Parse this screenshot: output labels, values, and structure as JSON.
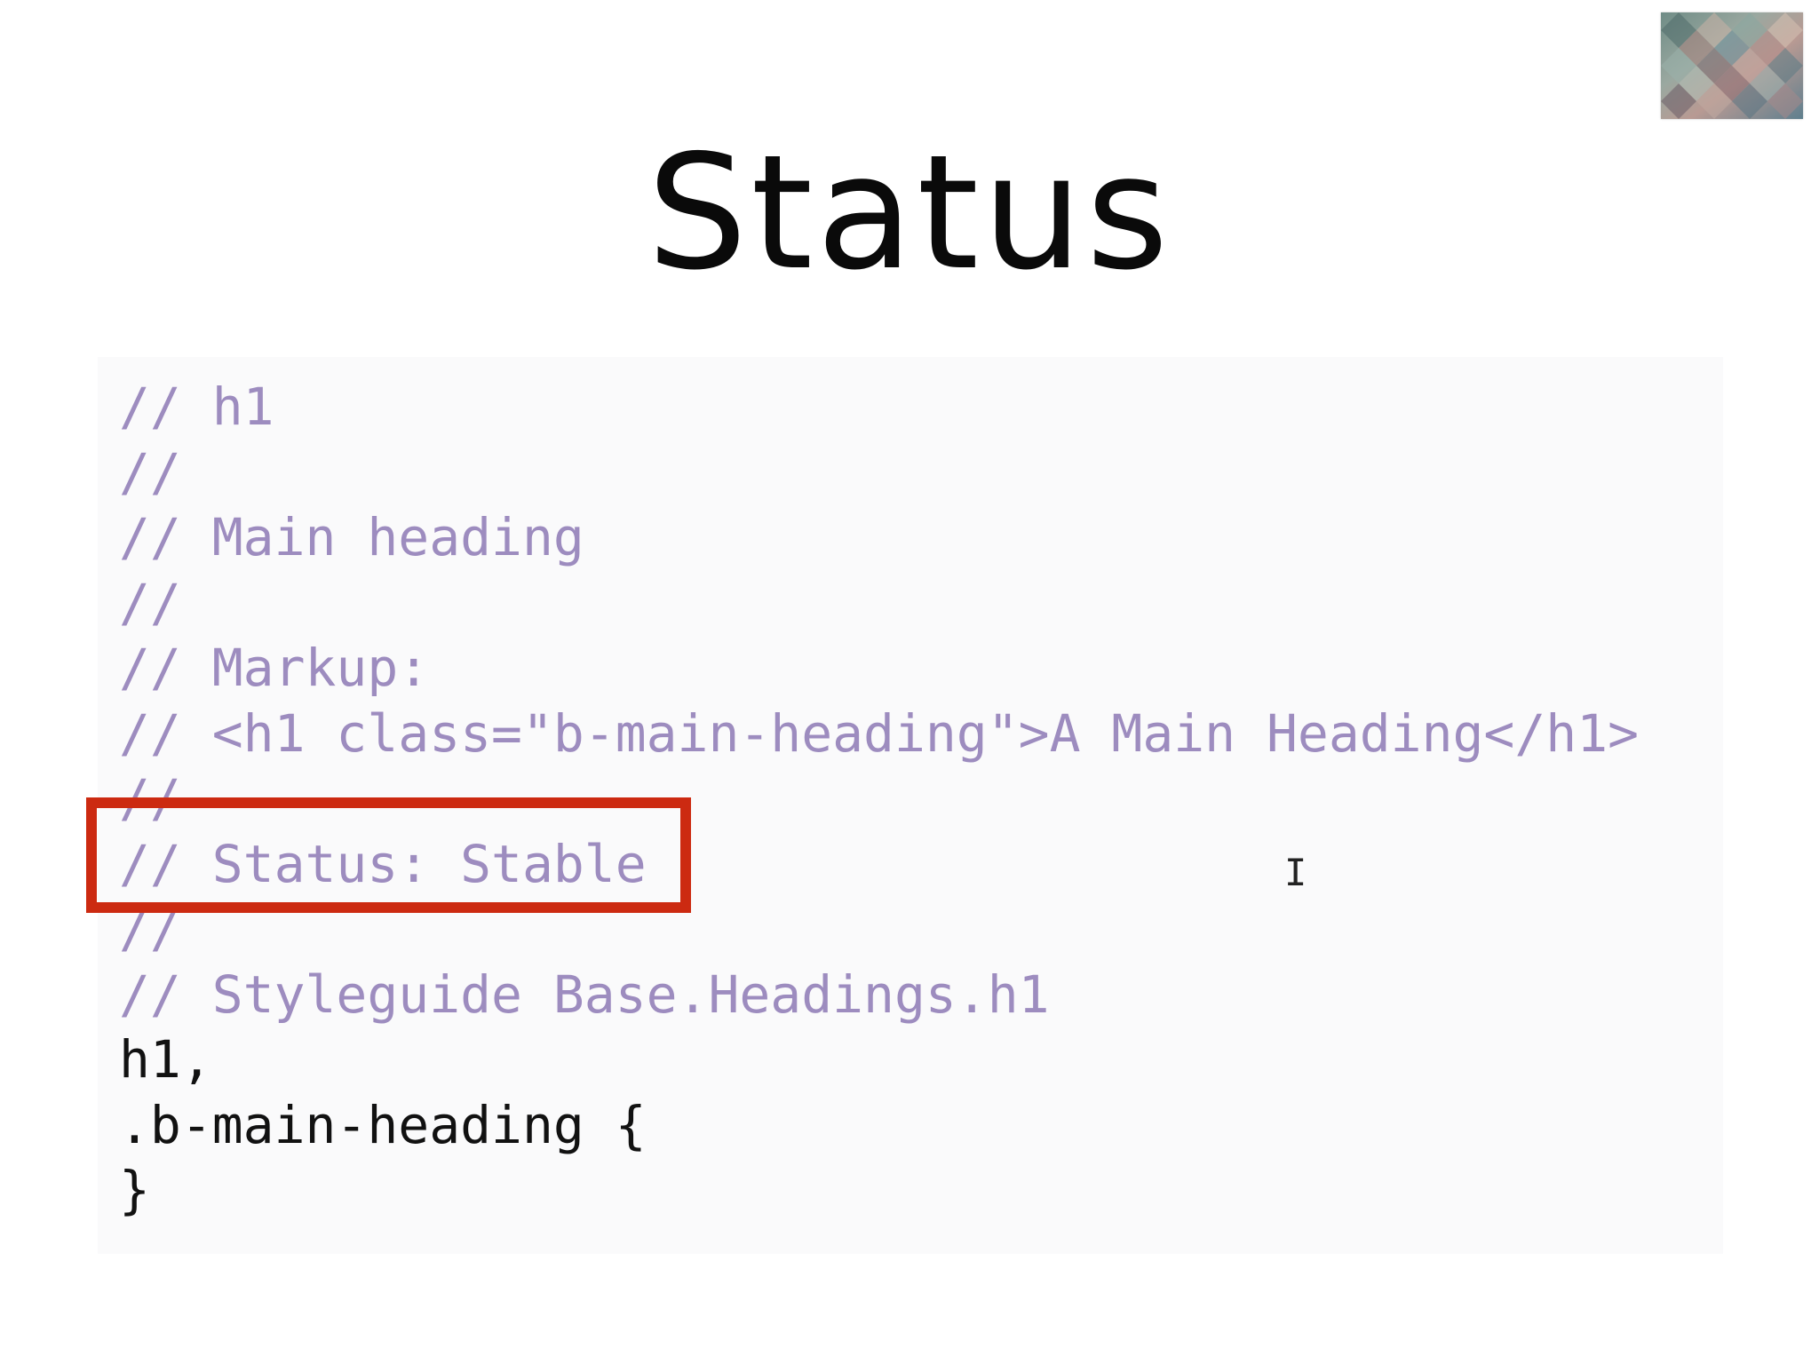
{
  "slide": {
    "title": "Status",
    "thumbnail_icon": "presenter-video-thumbnail"
  },
  "code": {
    "lines": [
      {
        "text": "// h1",
        "kind": "comment"
      },
      {
        "text": "//",
        "kind": "comment"
      },
      {
        "text": "// Main heading",
        "kind": "comment"
      },
      {
        "text": "//",
        "kind": "comment"
      },
      {
        "text": "// Markup:",
        "kind": "comment"
      },
      {
        "text": "// <h1 class=\"b-main-heading\">A Main Heading</h1>",
        "kind": "comment"
      },
      {
        "text": "//",
        "kind": "comment"
      },
      {
        "text": "// Status: Stable",
        "kind": "comment"
      },
      {
        "text": "//",
        "kind": "comment"
      },
      {
        "text": "// Styleguide Base.Headings.h1",
        "kind": "comment"
      },
      {
        "text": "h1,",
        "kind": "code"
      },
      {
        "text": ".b-main-heading {",
        "kind": "code"
      },
      {
        "text": "}",
        "kind": "code"
      }
    ],
    "highlighted_line": "// Status: Stable"
  },
  "colors": {
    "comment": "#9d8cbf",
    "code": "#111111",
    "highlight_border": "#cc2a11",
    "panel_background": "#fafafb"
  },
  "cursor": {
    "icon": "text-cursor-icon",
    "glyph": "I"
  }
}
